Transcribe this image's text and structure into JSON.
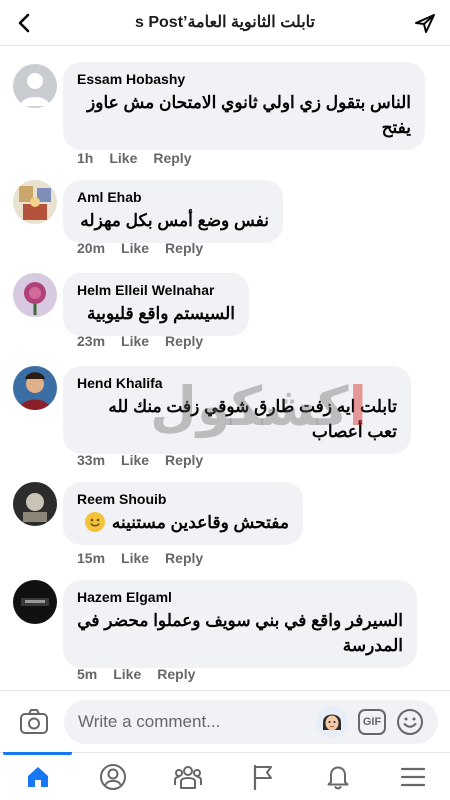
{
  "header": {
    "title": "تابلت الثانوية العامة’s Post"
  },
  "comments": [
    {
      "author": "Essam Hobashy",
      "text": "الناس بتقول زي اولي ثانوي الامتحان مش عاوز يفتح",
      "time": "1h",
      "like": "Like",
      "reply": "Reply"
    },
    {
      "author": "Aml Ehab",
      "text": "نفس وضع أمس بكل مهزله",
      "time": "20m",
      "like": "Like",
      "reply": "Reply"
    },
    {
      "author": "Helm Elleil Welnahar",
      "text": "السيستم واقع قليوبية",
      "time": "23m",
      "like": "Like",
      "reply": "Reply"
    },
    {
      "author": "Hend Khalifa",
      "text": "تابلت ايه زفت طارق شوقي زفت منك لله تعب أعصاب",
      "time": "33m",
      "like": "Like",
      "reply": "Reply"
    },
    {
      "author": "Reem Shouib",
      "text": "مفتحش وقاعدين مستنينه",
      "time": "15m",
      "like": "Like",
      "reply": "Reply"
    },
    {
      "author": "Hazem Elgaml",
      "text": "السيرفر واقع في بني سويف وعملوا محضر في المدرسة",
      "time": "5m",
      "like": "Like",
      "reply": "Reply"
    }
  ],
  "composer": {
    "placeholder": "Write a comment...",
    "gif_label": "GIF"
  },
  "watermark": {
    "text_gray": "كشك",
    "text_red": "ا",
    "text_tail": "ول"
  },
  "tabs": [
    {
      "name": "home-icon",
      "active": true
    },
    {
      "name": "profile-icon",
      "active": false
    },
    {
      "name": "groups-icon",
      "active": false
    },
    {
      "name": "pages-flag-icon",
      "active": false
    },
    {
      "name": "notifications-bell-icon",
      "active": false
    },
    {
      "name": "menu-icon",
      "active": false
    }
  ],
  "colors": {
    "accent": "#1877f2",
    "bubble": "#f0f2f5",
    "meta_text": "#65676b"
  }
}
